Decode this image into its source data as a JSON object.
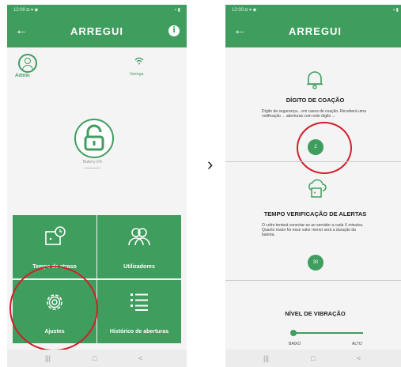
{
  "app": {
    "title": "ARREGUI",
    "back_glyph": "←",
    "info_glyph": "i"
  },
  "status": {
    "left": "12:00 ◘ ▾ ◆",
    "right": "▪ ▮"
  },
  "nav": {
    "recent": "|||",
    "home": "□",
    "back": "<"
  },
  "screen1": {
    "admin_label": "Admin",
    "wifi_label": "Varrega",
    "battery_label": "Battery 6%",
    "tiles": [
      {
        "label": "Tempo de atraso",
        "icon": "door-clock-icon"
      },
      {
        "label": "Utilizadores",
        "icon": "users-icon"
      },
      {
        "label": "Ajustes",
        "icon": "gear-icon"
      },
      {
        "label": "Histórico de aberturas",
        "icon": "list-icon"
      }
    ]
  },
  "arrow": "›",
  "screen2": {
    "section1": {
      "title": "DÍGITO DE COAÇÃO",
      "desc": "Dígito de segurança... em casos de coação. Receberá uma notificação ... aberturas com este dígito ... ",
      "value": "2"
    },
    "section2": {
      "title": "TEMPO VERIFICAÇÃO DE ALERTAS",
      "desc": "O cofre tentará conectar-se ao servidor a cada X minutos. Quanto maior for esse valor menor será a duração da bateria.",
      "value": "30"
    },
    "section3": {
      "title": "NÍVEL DE VIBRAÇÃO",
      "low": "BAIXO",
      "high": "ALTO",
      "level": 0
    }
  },
  "colors": {
    "primary": "#3f9d5e",
    "highlight": "#d21f2b"
  }
}
